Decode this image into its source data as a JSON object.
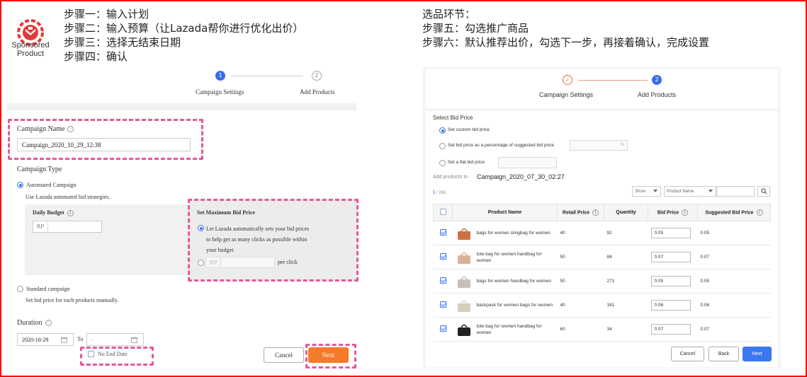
{
  "logo": {
    "text_line1": "Sponsored",
    "text_line2": "Product"
  },
  "instructions_left": [
    "步骤一：输入计划",
    "步骤二：输入预算（让Lazada帮你进行优化出价）",
    "步骤三：选择无结束日期",
    "步骤四：确认"
  ],
  "instructions_right": [
    "选品环节：",
    "步骤五：勾选推广商品",
    "步骤六：默认推荐出价，勾选下一步，再接着确认，完成设置"
  ],
  "left": {
    "stepper": {
      "step1_num": "1",
      "step2_num": "2",
      "step1_label": "Campaign Settings",
      "step2_label": "Add Products"
    },
    "campaign_name_label": "Campaign Name",
    "campaign_name_value": "Campaign_2020_10_29_12:38",
    "campaign_type_label": "Campaign Type",
    "automated_label": "Automated Campaign",
    "automated_desc": "Use Lazada automated bid strategies.",
    "daily_budget_label": "Daily Budget",
    "rp": "RP",
    "max_bid_label": "Set Maximum Bid Price",
    "auto_bid_line1": "Let Lazada automatically sets your bid prices",
    "auto_bid_line2": "to help get as many clicks as possible within",
    "auto_bid_line3": "your budget",
    "per_click": "per click",
    "standard_label": "Standard campaign",
    "standard_desc": "Set bid price for each products manually.",
    "duration_label": "Duration",
    "start_date": "2020-10-29",
    "to_label": "To",
    "end_date": "-",
    "no_end_date": "No End Date",
    "cancel": "Cancel",
    "next": "Next"
  },
  "right": {
    "stepper": {
      "step1_num": "✓",
      "step2_num": "2",
      "step1_label": "Campaign Settings",
      "step2_label": "Add Products"
    },
    "select_bid_price": "Select Bid Price",
    "opt_custom": "Set custom bid price",
    "opt_percentage": "Set bid price as a percentage of suggested bid price",
    "percent_sign": "%",
    "opt_flat": "Set a flat bid price",
    "add_products_to": "Add products to",
    "campaign_name": "Campaign_2020_07_30_02:27",
    "count_selected": "5",
    "count_total": " / 200",
    "show": "Show",
    "product_name_select": "Product Name",
    "columns": [
      "Product Name",
      "Retail Price",
      "Quantity",
      "Bid Price",
      "Suggested Bid Price"
    ],
    "rows": [
      {
        "name": "bags  for women slingbag for women",
        "retail": "40",
        "qty": "92",
        "bid": "0.05",
        "suggested": "0.05",
        "color": "#c87046"
      },
      {
        "name": "tote bag  for women  handbag for women",
        "retail": "50",
        "qty": "84",
        "bid": "0.07",
        "suggested": "0.07",
        "color": "#d9b29a"
      },
      {
        "name": "bags  for women handbag  for women",
        "retail": "50",
        "qty": "271",
        "bid": "0.05",
        "suggested": "0.05",
        "color": "#c9bfb4"
      },
      {
        "name": "backpack for women bags  for women",
        "retail": "40",
        "qty": "181",
        "bid": "0.06",
        "suggested": "0.06",
        "color": "#d8cdb8"
      },
      {
        "name": "tote bag  for women  handbag for women",
        "retail": "60",
        "qty": "34",
        "bid": "0.07",
        "suggested": "0.07",
        "color": "#222222"
      }
    ],
    "cancel": "Cancel",
    "back": "Back",
    "next": "Next"
  }
}
